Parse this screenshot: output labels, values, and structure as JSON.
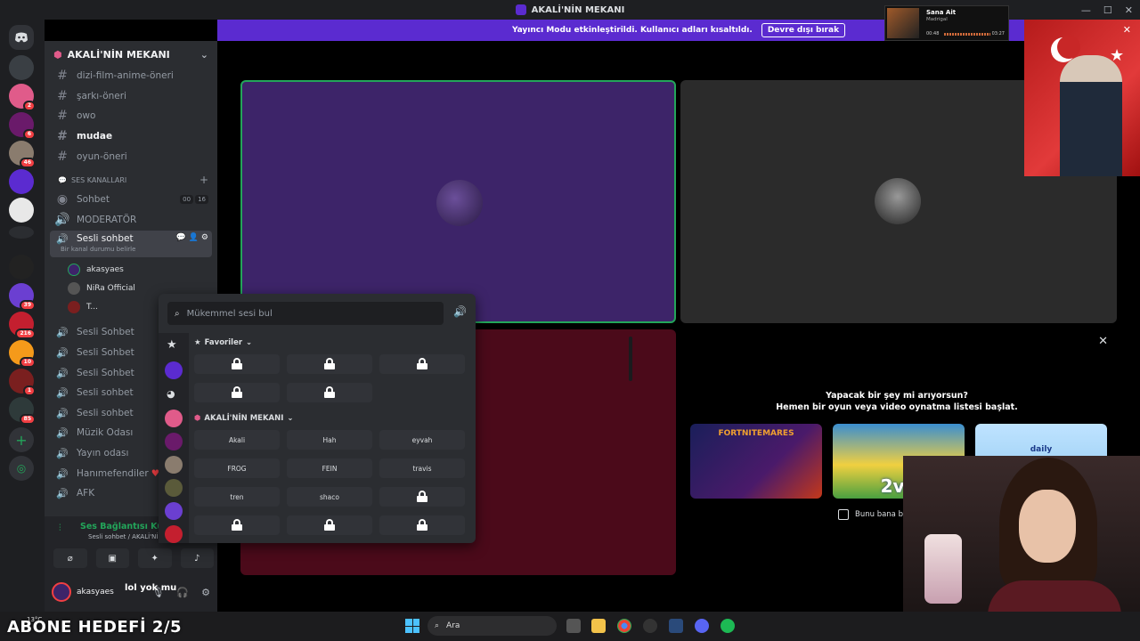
{
  "window": {
    "title": "AKALİ'NİN MEKANI"
  },
  "notice": {
    "text": "Yayıncı Modu etkinleştirildi. Kullanıcı adları kısaltıldı.",
    "button": "Devre dışı bırak"
  },
  "music": {
    "title": "Sana Ait",
    "artist": "Madrigal",
    "elapsed": "00:48",
    "total": "03:27"
  },
  "sidebar": {
    "guild_name": "AKALİ'NİN MEKANI",
    "text_channels": [
      {
        "label": "dizi-film-anime-öneri"
      },
      {
        "label": "şarkı-öneri"
      },
      {
        "label": "owo"
      },
      {
        "label": "mudae"
      },
      {
        "label": "oyun-öneri"
      }
    ],
    "category": "SES KANALLARI",
    "voice_channels": [
      {
        "label": "Sohbet",
        "count_a": "00",
        "count_b": "16"
      },
      {
        "label": "MODERATÖR"
      },
      {
        "label": "Sesli sohbet",
        "status": "Bir kanal durumu belirle"
      },
      {
        "label": "Sesli Sohbet"
      },
      {
        "label": "Sesli Sohbet"
      },
      {
        "label": "Sesli Sohbet"
      },
      {
        "label": "Sesli sohbet"
      },
      {
        "label": "Sesli sohbet"
      },
      {
        "label": "Müzik Odası"
      },
      {
        "label": "Yayın odası"
      },
      {
        "label": "Hanımefendiler"
      },
      {
        "label": "AFK"
      }
    ],
    "members": [
      "akasyaes",
      "NiRa Official",
      "T..."
    ]
  },
  "server_badges": [
    "2",
    "6",
    "46",
    "39",
    "216",
    "10",
    "1",
    "85"
  ],
  "voice_panel": {
    "status": "Ses Bağlantısı Kuruldu",
    "subtitle": "Sesli sohbet / AKALİ'NİN MEKANI",
    "username": "akasyaes",
    "overlay_text": "lol yok mu"
  },
  "picker": {
    "search_placeholder": "Mükemmel sesi bul",
    "favorites_label": "Favoriler",
    "server_label": "AKALİ'NİN MEKANI",
    "favorites": [
      "",
      "",
      "",
      "",
      ""
    ],
    "sounds": [
      "Akali",
      "Hah",
      "eyvah",
      "FROG",
      "FEIN",
      "travis",
      "tren",
      "shaco",
      "",
      "",
      "",
      ""
    ]
  },
  "activities": {
    "line1": "Yapacak bir şey mi arıyorsun?",
    "line2": "Hemen bir oyun veya video oynatma listesi başlat.",
    "checkbox_label": "Bunu bana bir",
    "cards": [
      "FORTNITEMARES",
      "2v2",
      "daily"
    ]
  },
  "taskbar": {
    "search": "Ara",
    "weather": "13°C"
  },
  "stream_overlay": {
    "subscriber_goal": "ABONE HEDEFİ 2/5"
  },
  "colors": {
    "accent": "#5b2bd0",
    "green": "#23a55a",
    "tile_purple": "#3d2469",
    "tile_red": "#4b0a1a"
  }
}
